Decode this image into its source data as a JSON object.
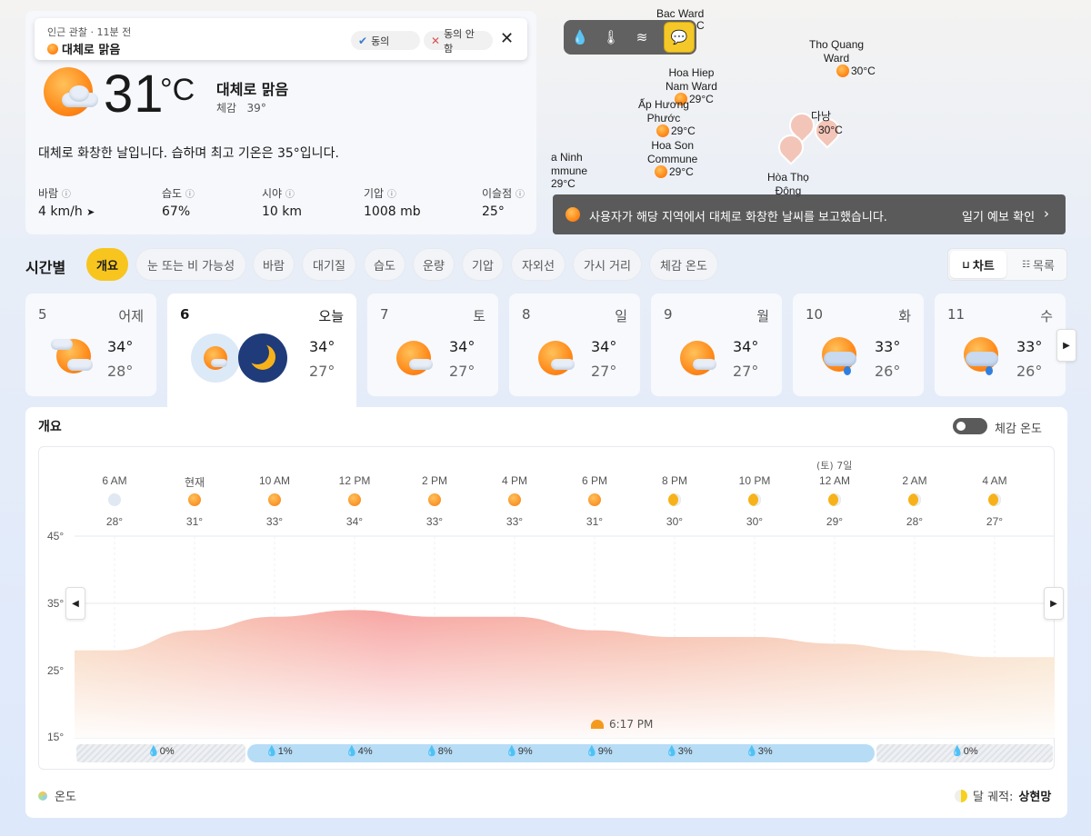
{
  "current": {
    "toast_meta": "인근 관찰 · 11분 전",
    "toast_condition": "대체로 맑음",
    "agree_label": "동의",
    "disagree_label": "동의 안 함",
    "temperature": "31",
    "unit": "°C",
    "condition": "대체로 맑음",
    "feels_like_label": "체감",
    "feels_like": "39°",
    "summary": "대체로 화창한 날입니다. 습하며 최고 기온은 35°입니다.",
    "stats": [
      {
        "label": "바람",
        "value": "4 km/h"
      },
      {
        "label": "습도",
        "value": "67%"
      },
      {
        "label": "시야",
        "value": "10 km"
      },
      {
        "label": "기압",
        "value": "1008 mb"
      },
      {
        "label": "이슬점",
        "value": "25°"
      }
    ]
  },
  "map": {
    "places": [
      {
        "name": "Bac Ward",
        "temp": "C"
      },
      {
        "name": "Tho Quang\nWard",
        "temp": "30°C"
      },
      {
        "name": "Hoa Hiep\nNam Ward",
        "temp": "29°C"
      },
      {
        "name": "Ấp Hương\nPhước",
        "temp": "29°C"
      },
      {
        "name": "Hoa Son\nCommune",
        "temp": "29°C"
      },
      {
        "name": "a Ninh\nmmune",
        "temp": "29°C"
      },
      {
        "name": "다낭",
        "temp": "30°C"
      },
      {
        "name": "Hòa Thọ\nĐông",
        "temp": ""
      }
    ],
    "report_text": "사용자가 해당 지역에서 대체로 화창한 날씨를 보고했습니다.",
    "report_link": "일기 예보 확인"
  },
  "hourly": {
    "title": "시간별",
    "tabs": [
      "개요",
      "눈 또는 비 가능성",
      "바람",
      "대기질",
      "습도",
      "운량",
      "기압",
      "자외선",
      "가시 거리",
      "체감 온도"
    ],
    "active_tab": "개요",
    "view_chart": "차트",
    "view_list": "목록"
  },
  "days": [
    {
      "num": "5",
      "weekday": "어제",
      "hi": "34°",
      "lo": "28°"
    },
    {
      "num": "6",
      "weekday": "오늘",
      "hi": "34°",
      "lo": "27°"
    },
    {
      "num": "7",
      "weekday": "토",
      "hi": "34°",
      "lo": "27°"
    },
    {
      "num": "8",
      "weekday": "일",
      "hi": "34°",
      "lo": "27°"
    },
    {
      "num": "9",
      "weekday": "월",
      "hi": "34°",
      "lo": "27°"
    },
    {
      "num": "10",
      "weekday": "화",
      "hi": "33°",
      "lo": "26°"
    },
    {
      "num": "11",
      "weekday": "수",
      "hi": "33°",
      "lo": "26°"
    }
  ],
  "overview": {
    "title": "개요",
    "toggle_label": "체감 온도",
    "next_day_label": "(토) 7일",
    "sunset_label": "6:17 PM",
    "legend_label": "온도",
    "moon_label": "달 궤적:",
    "moon_phase": "상현망"
  },
  "chart_data": {
    "type": "area",
    "title": "",
    "x": [
      "6 AM",
      "현재",
      "10 AM",
      "12 PM",
      "2 PM",
      "4 PM",
      "6 PM",
      "8 PM",
      "10 PM",
      "12 AM",
      "2 AM",
      "4 AM"
    ],
    "series": [
      {
        "values": [
          28,
          31,
          33,
          34,
          33,
          33,
          31,
          30,
          30,
          29,
          28,
          27
        ]
      }
    ],
    "y_ticks": [
      "45°",
      "35°",
      "25°",
      "15°"
    ],
    "ylim": [
      15,
      45
    ],
    "precipitation": [
      "0%",
      "1%",
      "4%",
      "8%",
      "9%",
      "9%",
      "3%",
      "3%",
      "0%"
    ],
    "grid": true
  }
}
